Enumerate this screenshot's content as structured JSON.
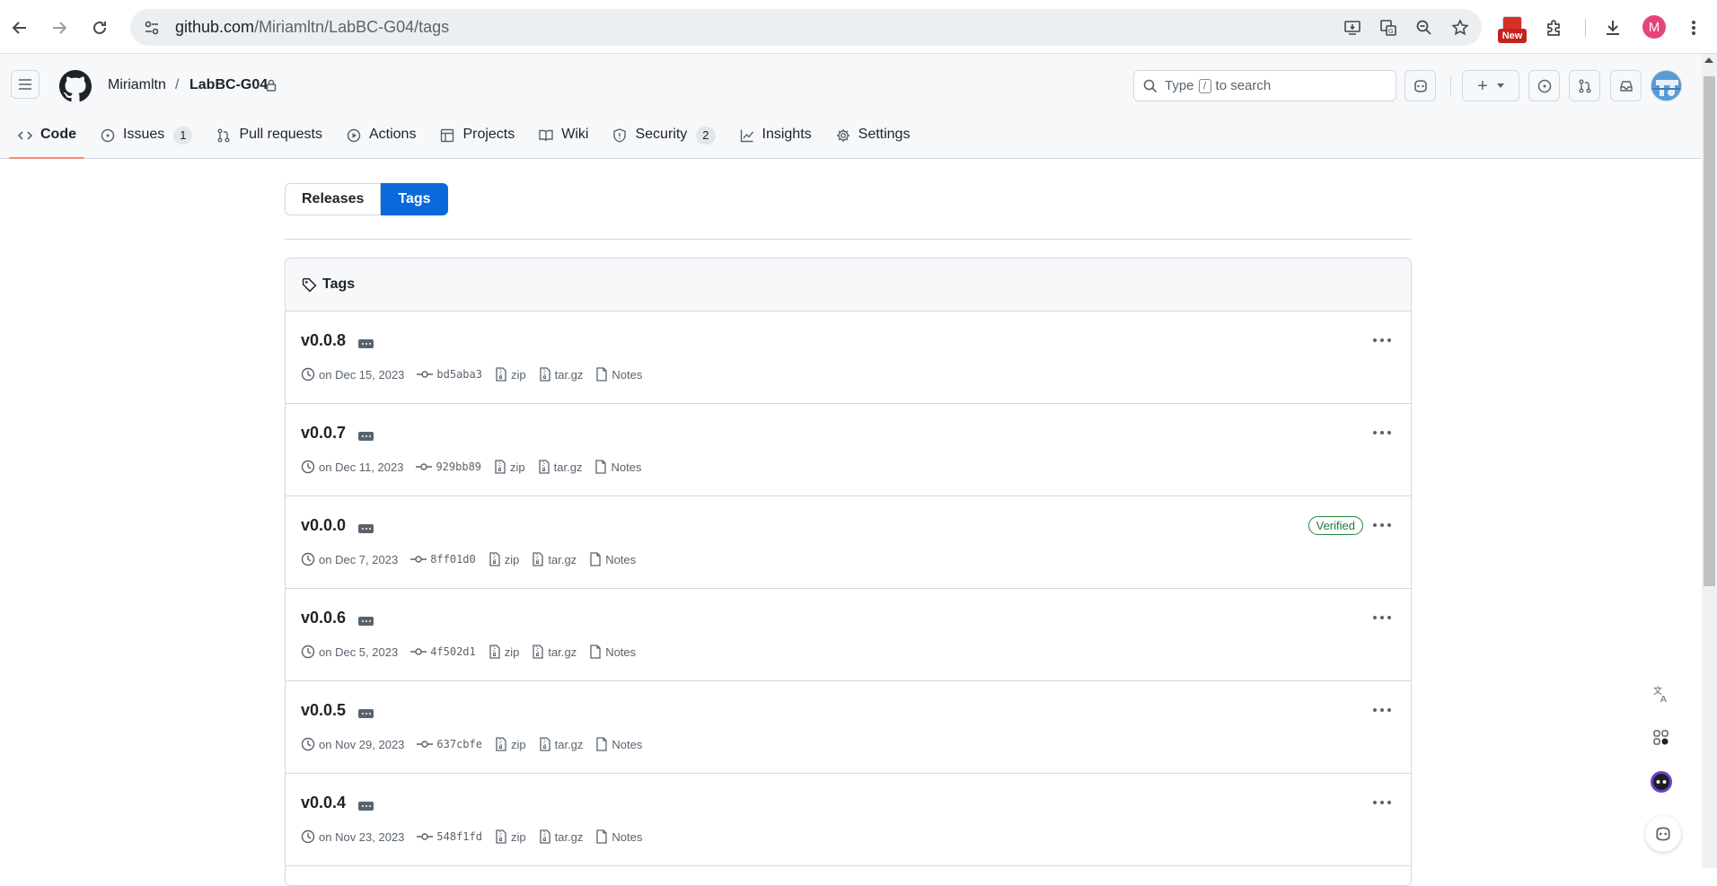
{
  "browser": {
    "url_host": "github.com",
    "url_path": "/Miriamltn/LabBC-G04/tags",
    "new_badge": "New",
    "profile_initial": "M"
  },
  "header": {
    "owner": "Miriamltn",
    "separator": "/",
    "repo": "LabBC-G04",
    "search_prefix": "Type",
    "search_key": "/",
    "search_suffix": "to search",
    "add_label": "+"
  },
  "nav": {
    "items": [
      {
        "label": "Code",
        "icon": "code-icon",
        "active": true
      },
      {
        "label": "Issues",
        "icon": "issue-icon",
        "count": "1"
      },
      {
        "label": "Pull requests",
        "icon": "pull-request-icon"
      },
      {
        "label": "Actions",
        "icon": "play-icon"
      },
      {
        "label": "Projects",
        "icon": "table-icon"
      },
      {
        "label": "Wiki",
        "icon": "book-icon"
      },
      {
        "label": "Security",
        "icon": "shield-icon",
        "count": "2"
      },
      {
        "label": "Insights",
        "icon": "graph-icon"
      },
      {
        "label": "Settings",
        "icon": "gear-icon"
      }
    ]
  },
  "subnav": {
    "releases": "Releases",
    "tags": "Tags"
  },
  "tags_box": {
    "title": "Tags",
    "rows": [
      {
        "name": "v0.0.8",
        "date": "on Dec 15, 2023",
        "sha": "bd5aba3",
        "zip": "zip",
        "targz": "tar.gz",
        "notes": "Notes",
        "verified": ""
      },
      {
        "name": "v0.0.7",
        "date": "on Dec 11, 2023",
        "sha": "929bb89",
        "zip": "zip",
        "targz": "tar.gz",
        "notes": "Notes",
        "verified": ""
      },
      {
        "name": "v0.0.0",
        "date": "on Dec 7, 2023",
        "sha": "8ff01d0",
        "zip": "zip",
        "targz": "tar.gz",
        "notes": "Notes",
        "verified": "Verified"
      },
      {
        "name": "v0.0.6",
        "date": "on Dec 5, 2023",
        "sha": "4f502d1",
        "zip": "zip",
        "targz": "tar.gz",
        "notes": "Notes",
        "verified": ""
      },
      {
        "name": "v0.0.5",
        "date": "on Nov 29, 2023",
        "sha": "637cbfe",
        "zip": "zip",
        "targz": "tar.gz",
        "notes": "Notes",
        "verified": ""
      },
      {
        "name": "v0.0.4",
        "date": "on Nov 23, 2023",
        "sha": "548f1fd",
        "zip": "zip",
        "targz": "tar.gz",
        "notes": "Notes",
        "verified": ""
      }
    ]
  },
  "colors": {
    "accent": "#0969da",
    "nav_underline": "#fd8c73",
    "verified": "#1a7f37",
    "badge_red": "#d93025"
  }
}
